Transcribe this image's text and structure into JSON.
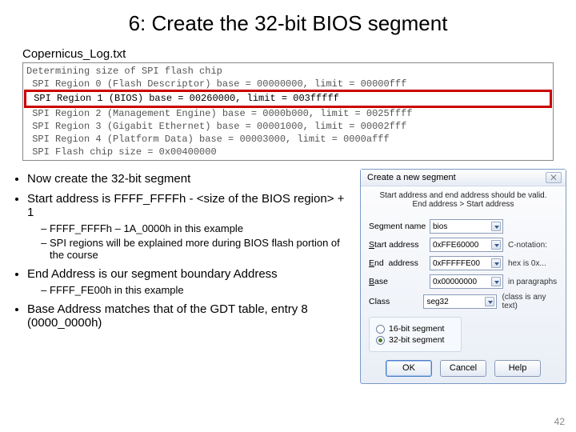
{
  "title": "6: Create the 32-bit BIOS segment",
  "log_file": "Copernicus_Log.txt",
  "log": {
    "l0": "Determining size of SPI flash chip",
    "l1": " SPI Region 0 (Flash Descriptor) base = 00000000, limit = 00000fff",
    "l2": " SPI Region 1 (BIOS) base = 00260000, limit = 003fffff",
    "l3": " SPI Region 2 (Management Engine) base = 0000b000, limit = 0025ffff",
    "l4": " SPI Region 3 (Gigabit Ethernet) base = 00001000, limit = 00002fff",
    "l5": " SPI Region 4 (Platform Data) base = 00003000, limit = 0000afff",
    "l6": " SPI Flash chip size = 0x00400000"
  },
  "bullets": {
    "b1": "Now create the 32-bit segment",
    "b2": "Start address is FFFF_FFFFh - <size of the BIOS region> + 1",
    "b2a": "FFFF_FFFFh – 1A_0000h in this example",
    "b2b": "SPI regions will be explained more during BIOS flash portion of the course",
    "b3": "End Address is our segment boundary Address",
    "b3a": "FFFF_FE00h in this example",
    "b4": "Base Address matches that of the GDT table, entry 8 (0000_0000h)"
  },
  "dialog": {
    "title": "Create a new segment",
    "hint": "Start address and end address should be valid.\nEnd address > Start address",
    "labels": {
      "segname": "Segment name",
      "start": "Start address",
      "end": "End  address",
      "base": "Base",
      "class": "Class"
    },
    "values": {
      "segname": "bios",
      "start": "0xFFE60000",
      "end": "0xFFFFFE00",
      "base": "0x00000000",
      "class": "seg32"
    },
    "notes": {
      "cnot": "C-notation:",
      "hex": "hex is 0x...",
      "para": "in paragraphs",
      "classnote": "(class is any text)"
    },
    "radio16": "16-bit segment",
    "radio32": "32-bit segment",
    "ok": "OK",
    "cancel": "Cancel",
    "help": "Help",
    "close_glyph": "⨉"
  },
  "page_number": "42"
}
